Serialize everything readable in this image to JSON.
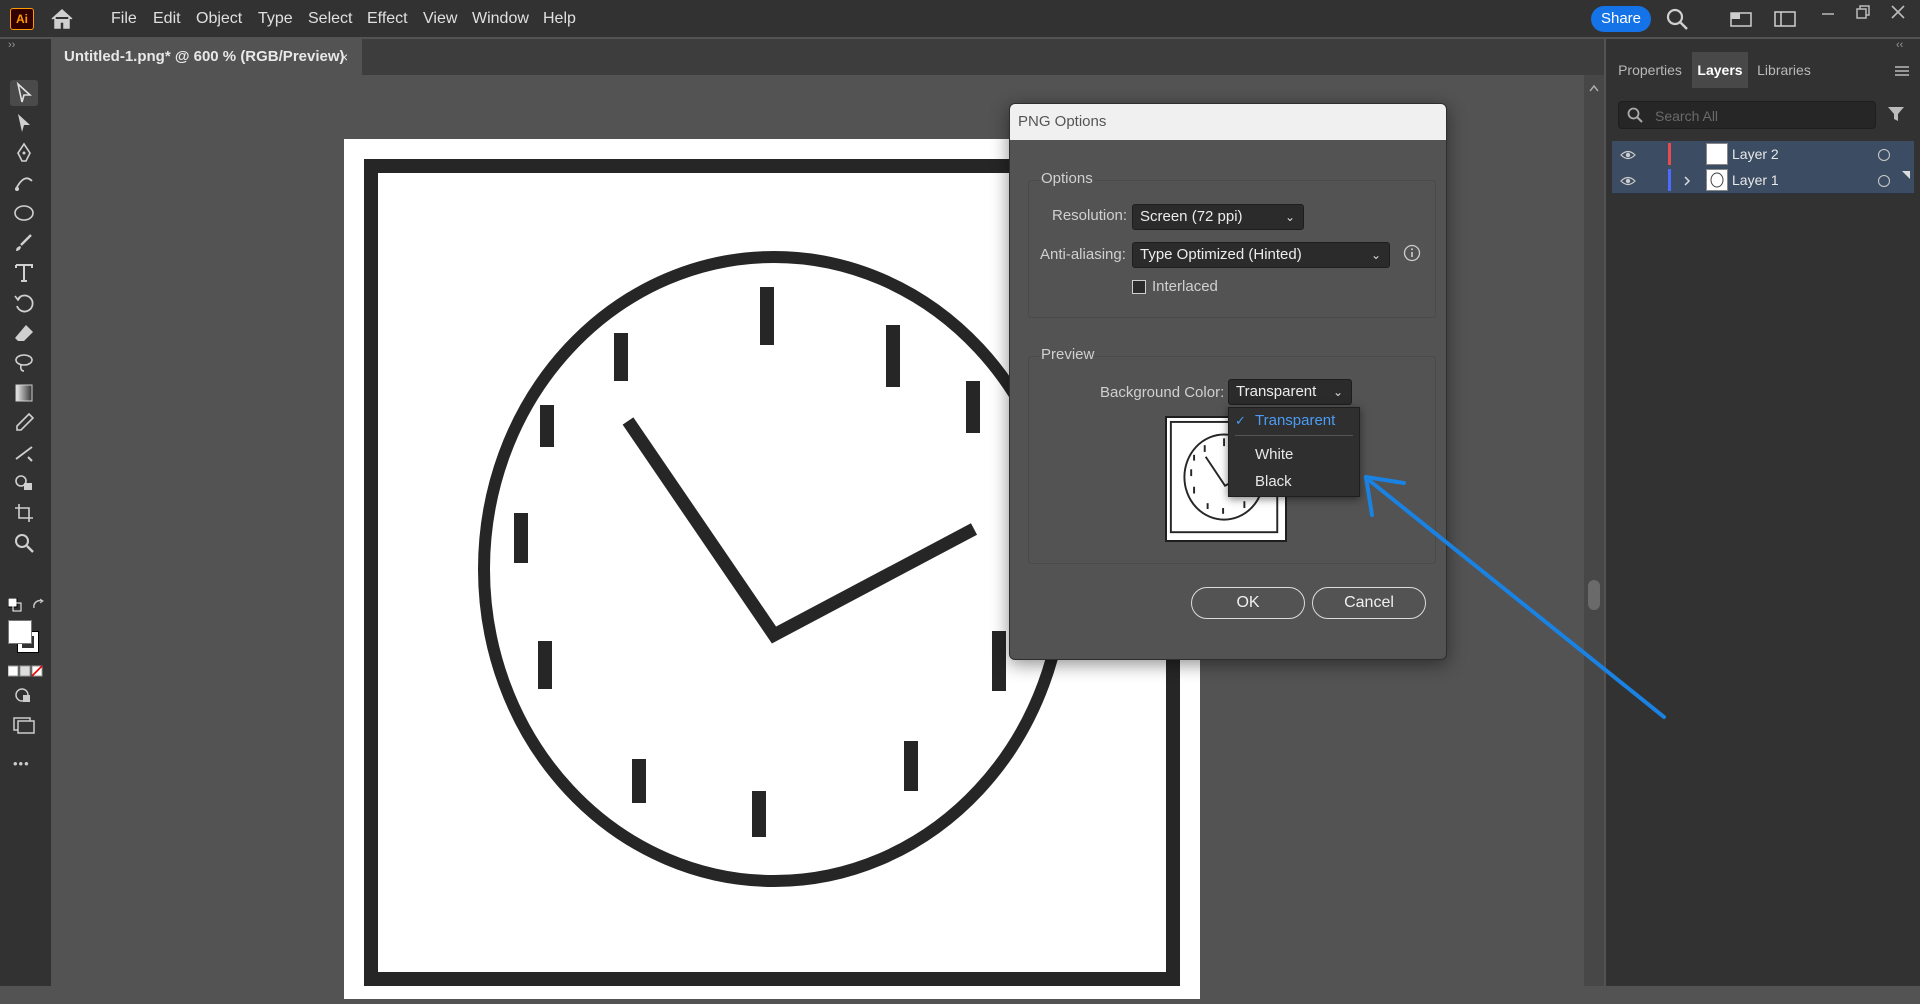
{
  "menubar": {
    "app_logo": "Ai",
    "items": [
      "File",
      "Edit",
      "Object",
      "Type",
      "Select",
      "Effect",
      "View",
      "Window",
      "Help"
    ],
    "share_label": "Share"
  },
  "document": {
    "tab_title": "Untitled-1.png* @ 600 % (RGB/Preview)",
    "close_glyph": "×"
  },
  "tools": [
    "selection-tool",
    "direct-selection-tool",
    "pen-tool",
    "curvature-tool",
    "ellipse-tool",
    "paintbrush-tool",
    "type-tool",
    "rotate-tool",
    "eraser-tool",
    "lasso-tool",
    "gradient-tool",
    "eyedropper-tool",
    "blend-tool",
    "live-paint-tool",
    "artboard-tool",
    "zoom-tool"
  ],
  "more_tools_glyph": "•••",
  "right_panel": {
    "tabs": [
      "Properties",
      "Layers",
      "Libraries"
    ],
    "active_tab": "Layers",
    "search_placeholder": "Search All",
    "layers": [
      {
        "name": "Layer 2",
        "color": "#e84b4b"
      },
      {
        "name": "Layer 1",
        "color": "#4b6bff"
      }
    ]
  },
  "dialog": {
    "title": "PNG Options",
    "options_group": "Options",
    "resolution_label": "Resolution:",
    "resolution_value": "Screen (72 ppi)",
    "antialias_label": "Anti-aliasing:",
    "antialias_value": "Type Optimized (Hinted)",
    "interlaced_label": "Interlaced",
    "interlaced_checked": false,
    "preview_group": "Preview",
    "bg_color_label": "Background Color:",
    "bg_color_value": "Transparent",
    "ok_label": "OK",
    "cancel_label": "Cancel"
  },
  "dropdown": {
    "options": [
      "Transparent",
      "White",
      "Black"
    ],
    "selected": "Transparent",
    "check_glyph": "✓"
  },
  "colors": {
    "accent": "#1473e6",
    "annotation_arrow": "#1a82e2",
    "selected_option": "#4b9cf5"
  }
}
